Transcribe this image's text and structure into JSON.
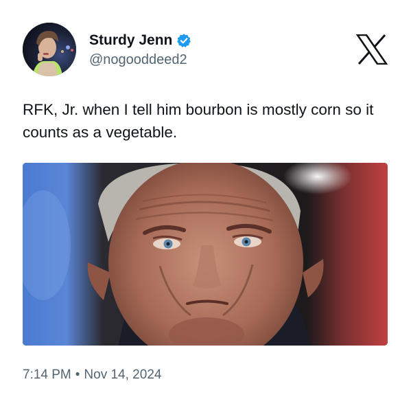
{
  "author": {
    "display_name": "Sturdy Jenn",
    "handle": "@nogooddeed2",
    "verified": true,
    "verified_color": "#1d9bf0",
    "avatar_icon": "profile-photo"
  },
  "brand": {
    "logo_icon": "x-logo"
  },
  "tweet": {
    "text": "RFK, Jr. when I tell him bourbon is mostly corn so it counts as a vegetable.",
    "media_type": "photo"
  },
  "meta": {
    "time": "7:14 PM",
    "separator": "•",
    "date": "Nov 14, 2024"
  },
  "colors": {
    "text_primary": "#0f1419",
    "text_secondary": "#536471",
    "background": "#ffffff"
  }
}
